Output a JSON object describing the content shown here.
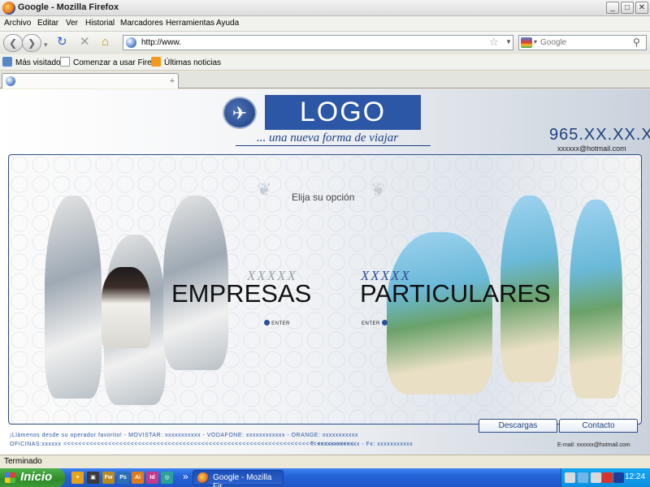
{
  "window": {
    "title": "Google - Mozilla Firefox"
  },
  "menu": [
    "Archivo",
    "Editar",
    "Ver",
    "Historial",
    "Marcadores",
    "Herramientas",
    "Ayuda"
  ],
  "nav": {
    "url": "http://www.",
    "search_placeholder": "Google"
  },
  "bookmarks": [
    "Más visitados",
    "Comenzar a usar Firef…",
    "Últimas noticias"
  ],
  "page": {
    "logo": "LOGO",
    "tagline": "... una nueva forma de viajar",
    "phone": "965.XX.XX.XX",
    "email_top": "xxxxxx@hotmail.com",
    "prompt": "Elija su opción",
    "left_option": {
      "kicker": "XXXXX",
      "title": "EMPRESAS",
      "enter": "ENTER"
    },
    "right_option": {
      "kicker": "XXXXX",
      "title": "PARTICULARES",
      "enter": "ENTER"
    },
    "tabs": {
      "descargas": "Descargas",
      "contacto": "Contacto"
    },
    "footer_line1": "¡Llámenos desde su operador favorito!  -  MOVISTAR: xxxxxxxxxxx  -  VODAFONE: xxxxxxxxxxxx  -  ORANGE: xxxxxxxxxxx",
    "footer_line2": "OFICINAS:xxxxxx <<<<<<<<<<<<<<<<<<<<<<<<<<<<<<<<<<<<<<<<<<<<<<<<<<<<<<<<<<<<<<<<<<<<<<<<<<<<<<",
    "footer_phones": "T: xxxxxxxxxxxxx  -  Fx: xxxxxxxxxxx",
    "email_footer": "E-mail: xxxxxx@hotmail.com"
  },
  "status": {
    "text": "Terminado"
  },
  "taskbar": {
    "start": "Inicio",
    "task": "Google - Mozilla Fir...",
    "clock": "12:24"
  }
}
